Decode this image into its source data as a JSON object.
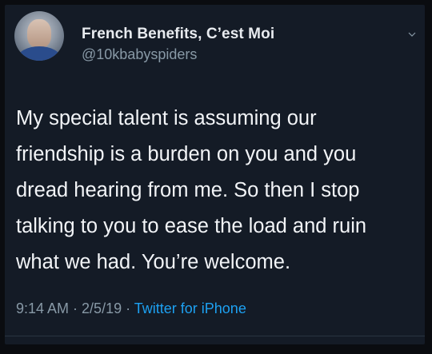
{
  "tweet": {
    "display_name": "French Benefits, C’est Moi",
    "handle": "@10kbabyspiders",
    "text_lines": [
      "My special talent is assuming our",
      "friendship is a burden on you and you",
      "dread hearing from me.  So then I stop",
      "talking to you to ease the load and ruin",
      "what we had.  You’re welcome."
    ],
    "time": "9:14 AM",
    "separator": " · ",
    "date": "2/5/19",
    "source": "Twitter for iPhone"
  },
  "icons": {
    "avatar": "profile-photo",
    "menu": "chevron-down-icon"
  },
  "colors": {
    "background": "#141b26",
    "text": "#f2f4f7",
    "secondary": "#8899a6",
    "link": "#1da1f2"
  }
}
